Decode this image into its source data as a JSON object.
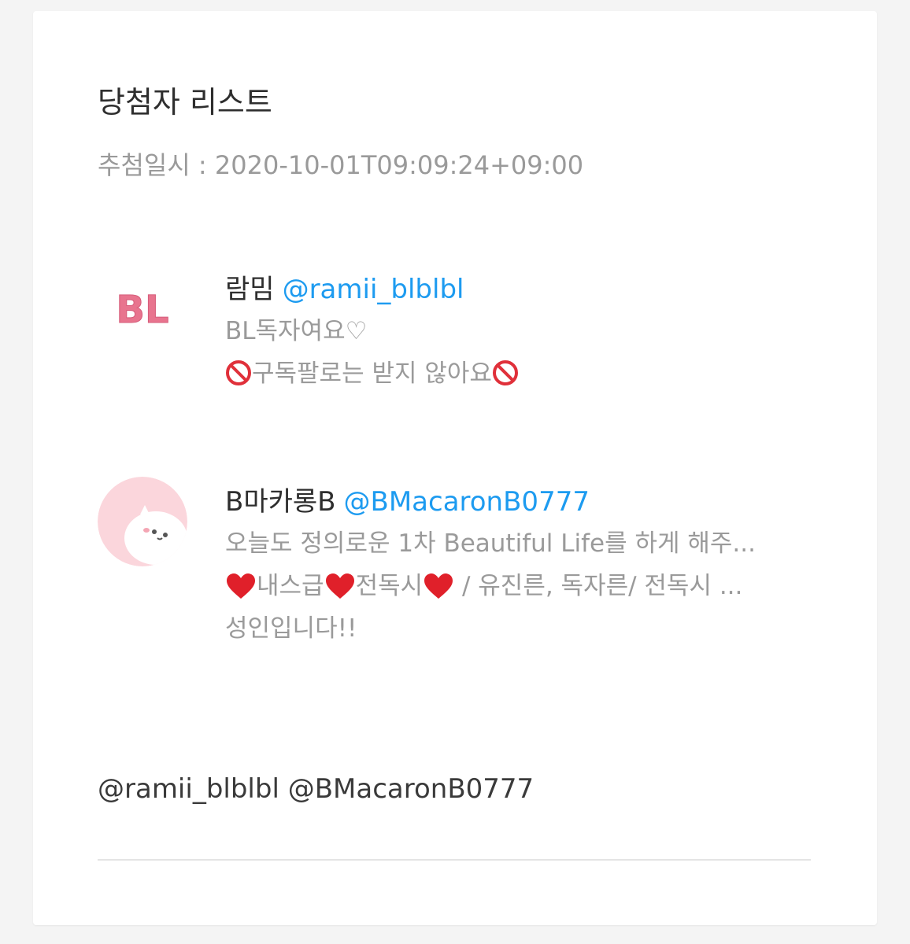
{
  "card": {
    "title": "당첨자 리스트",
    "draw_time_label": "추첨일시 : 2020-10-01T09:09:24+09:00"
  },
  "winners": [
    {
      "display_name": "람밈",
      "handle": "@ramii_blblbl",
      "avatar_icon": "bl-logo-avatar",
      "bio_line_1": "BL독자여요♡",
      "bio_line_2": "구독팔로는 받지 않아요"
    },
    {
      "display_name": "B마카롱B",
      "handle": "@BMacaronB0777",
      "avatar_icon": "pink-cat-avatar",
      "bio_line_1": "오늘도 정의로운 1차 Beautiful Life를 하게 해주...",
      "bio_line_2a": "내스급",
      "bio_line_2b": "전독시",
      "bio_line_2c": " / 유진른, 독자른/ 전독시 ...",
      "bio_line_3": "성인입니다!!"
    }
  ],
  "mentions": "@ramii_blblbl @BMacaronB0777",
  "colors": {
    "link": "#1d9bf0",
    "muted_text": "#9a9a9a",
    "primary_text": "#2e2e2e",
    "divider": "#e4e4e4"
  }
}
